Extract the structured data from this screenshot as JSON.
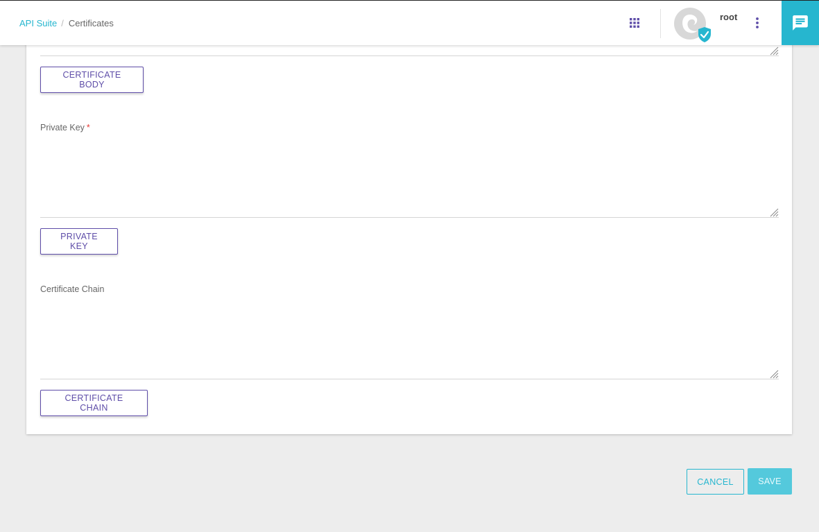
{
  "header": {
    "breadcrumb": [
      {
        "label": "API Suite",
        "link": true
      },
      {
        "label": "Certificates",
        "link": false
      }
    ],
    "username": "root",
    "icons": {
      "apps": "apps-grid-icon",
      "avatar": "avatar-verified-icon",
      "more": "more-vertical-icon",
      "chat": "chat-icon"
    },
    "colors": {
      "accent": "#26b6cf",
      "primary": "#5e4da8"
    }
  },
  "form": {
    "certificate_body": {
      "button_label": "CERTIFICATE BODY",
      "value": ""
    },
    "private_key": {
      "label": "Private Key",
      "required_mark": "*",
      "value": "",
      "button_label": "PRIVATE KEY"
    },
    "certificate_chain": {
      "label": "Certificate Chain",
      "value": "",
      "button_label": "CERTIFICATE CHAIN"
    }
  },
  "actions": {
    "cancel_label": "CANCEL",
    "save_label": "SAVE"
  }
}
